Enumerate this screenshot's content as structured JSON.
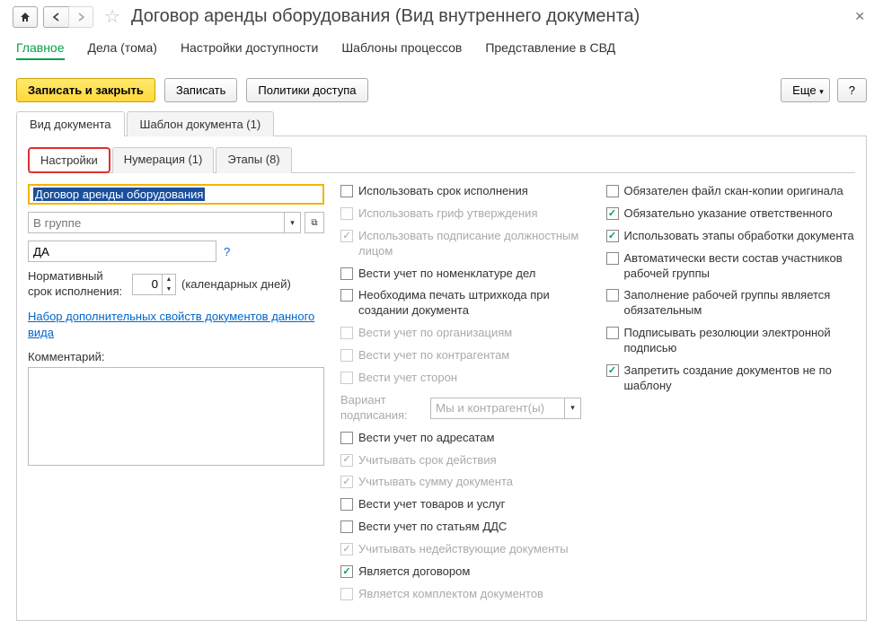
{
  "title": "Договор аренды оборудования (Вид внутреннего документа)",
  "nav": {
    "main": "Главное",
    "cases": "Дела (тома)",
    "access": "Настройки доступности",
    "templates": "Шаблоны процессов",
    "svd": "Представление в СВД"
  },
  "toolbar": {
    "save_close": "Записать и закрыть",
    "save": "Записать",
    "policies": "Политики доступа",
    "more": "Еще",
    "help": "?"
  },
  "tabs": {
    "doc_type": "Вид документа",
    "doc_template": "Шаблон документа (1)"
  },
  "subtabs": {
    "settings": "Настройки",
    "numbering": "Нумерация (1)",
    "stages": "Этапы (8)"
  },
  "left": {
    "name_value": "Договор аренды оборудования",
    "group_placeholder": "В группе",
    "code_value": "ДА",
    "help_q": "?",
    "norm_label": "Нормативный срок исполнения:",
    "days_value": "0",
    "days_suffix": "(календарных дней)",
    "link": "Набор дополнительных свойств документов данного вида",
    "comment_label": "Комментарий:"
  },
  "mid": {
    "checks": [
      {
        "label": "Использовать срок исполнения",
        "checked": false,
        "disabled": false
      },
      {
        "label": "Использовать гриф утверждения",
        "checked": false,
        "disabled": true
      },
      {
        "label": "Использовать подписание должностным лицом",
        "checked": true,
        "disabled": true
      },
      {
        "label": "Вести учет по номенклатуре дел",
        "checked": false,
        "disabled": false
      },
      {
        "label": "Необходима печать штрихкода при создании документа",
        "checked": false,
        "disabled": false
      },
      {
        "label": "Вести учет по организациям",
        "checked": false,
        "disabled": true
      },
      {
        "label": "Вести учет по контрагентам",
        "checked": false,
        "disabled": true
      },
      {
        "label": "Вести учет сторон",
        "checked": false,
        "disabled": true
      }
    ],
    "variant_label": "Вариант подписания:",
    "variant_value": "Мы и контрагент(ы)",
    "checks2": [
      {
        "label": "Вести учет по адресатам",
        "checked": false,
        "disabled": false
      },
      {
        "label": "Учитывать срок действия",
        "checked": true,
        "disabled": true
      },
      {
        "label": "Учитывать сумму документа",
        "checked": true,
        "disabled": true
      },
      {
        "label": "Вести учет товаров и услуг",
        "checked": false,
        "disabled": false
      },
      {
        "label": "Вести учет по статьям ДДС",
        "checked": false,
        "disabled": false
      },
      {
        "label": "Учитывать недействующие документы",
        "checked": true,
        "disabled": true
      },
      {
        "label": "Является договором",
        "checked": true,
        "disabled": false
      },
      {
        "label": "Является комплектом документов",
        "checked": false,
        "disabled": true
      }
    ]
  },
  "right": {
    "checks": [
      {
        "label": "Обязателен файл скан-копии оригинала",
        "checked": false,
        "disabled": false
      },
      {
        "label": "Обязательно указание ответственного",
        "checked": true,
        "disabled": false
      },
      {
        "label": "Использовать этапы обработки документа",
        "checked": true,
        "disabled": false
      },
      {
        "label": "Автоматически вести состав участников рабочей группы",
        "checked": false,
        "disabled": false
      },
      {
        "label": "Заполнение рабочей группы является обязательным",
        "checked": false,
        "disabled": false
      },
      {
        "label": "Подписывать резолюции электронной подписью",
        "checked": false,
        "disabled": false
      },
      {
        "label": "Запретить создание документов не по шаблону",
        "checked": true,
        "disabled": false
      }
    ]
  }
}
